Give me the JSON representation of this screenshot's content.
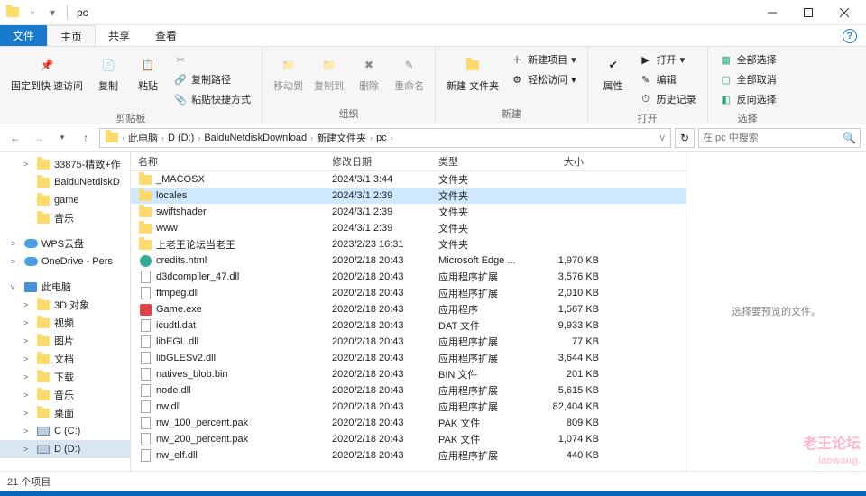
{
  "window": {
    "title": "pc"
  },
  "tabs": {
    "file": "文件",
    "home": "主页",
    "share": "共享",
    "view": "查看"
  },
  "ribbon": {
    "clipboard": {
      "label": "剪贴板",
      "pin": "固定到快\n速访问",
      "copy": "复制",
      "paste": "粘贴",
      "copy_path": "复制路径",
      "paste_shortcut": "粘贴快捷方式"
    },
    "organize": {
      "label": "组织",
      "move_to": "移动到",
      "copy_to": "复制到",
      "delete": "删除",
      "rename": "重命名"
    },
    "new": {
      "label": "新建",
      "new_folder": "新建\n文件夹",
      "new_item": "新建项目",
      "easy_access": "轻松访问"
    },
    "open": {
      "label": "打开",
      "properties": "属性",
      "open": "打开",
      "edit": "编辑",
      "history": "历史记录"
    },
    "select": {
      "label": "选择",
      "select_all": "全部选择",
      "select_none": "全部取消",
      "invert": "反向选择"
    }
  },
  "breadcrumb": [
    "此电脑",
    "D (D:)",
    "BaiduNetdiskDownload",
    "新建文件夹",
    "pc"
  ],
  "addr": {
    "dropdown": "v",
    "refresh": "↻"
  },
  "search": {
    "placeholder": "在 pc 中搜索"
  },
  "columns": {
    "name": "名称",
    "date": "修改日期",
    "type": "类型",
    "size": "大小"
  },
  "tree": {
    "items": [
      {
        "label": "33875-精致+作",
        "icon": "folder",
        "indent": 1,
        "exp": ">"
      },
      {
        "label": "BaiduNetdiskD",
        "icon": "folder",
        "indent": 1
      },
      {
        "label": "game",
        "icon": "folder",
        "indent": 1
      },
      {
        "label": "音乐",
        "icon": "folder",
        "indent": 1
      },
      {
        "sep": true
      },
      {
        "label": "WPS云盘",
        "icon": "cloud",
        "indent": 0,
        "exp": ">"
      },
      {
        "label": "OneDrive - Pers",
        "icon": "cloud",
        "indent": 0,
        "exp": ">"
      },
      {
        "sep": true
      },
      {
        "label": "此电脑",
        "icon": "pc",
        "indent": 0,
        "exp": "v"
      },
      {
        "label": "3D 对象",
        "icon": "folder",
        "indent": 1,
        "exp": ">"
      },
      {
        "label": "视频",
        "icon": "folder",
        "indent": 1,
        "exp": ">"
      },
      {
        "label": "图片",
        "icon": "folder",
        "indent": 1,
        "exp": ">"
      },
      {
        "label": "文档",
        "icon": "folder",
        "indent": 1,
        "exp": ">"
      },
      {
        "label": "下载",
        "icon": "folder",
        "indent": 1,
        "exp": ">"
      },
      {
        "label": "音乐",
        "icon": "folder",
        "indent": 1,
        "exp": ">"
      },
      {
        "label": "桌面",
        "icon": "folder",
        "indent": 1,
        "exp": ">"
      },
      {
        "label": "C (C:)",
        "icon": "drive",
        "indent": 1,
        "exp": ">"
      },
      {
        "label": "D (D:)",
        "icon": "drive",
        "indent": 1,
        "exp": ">",
        "sel": true
      }
    ]
  },
  "files": [
    {
      "name": "_MACOSX",
      "date": "2024/3/1 3:44",
      "type": "文件夹",
      "size": "",
      "icon": "folder"
    },
    {
      "name": "locales",
      "date": "2024/3/1 2:39",
      "type": "文件夹",
      "size": "",
      "icon": "folder",
      "sel": true
    },
    {
      "name": "swiftshader",
      "date": "2024/3/1 2:39",
      "type": "文件夹",
      "size": "",
      "icon": "folder"
    },
    {
      "name": "www",
      "date": "2024/3/1 2:39",
      "type": "文件夹",
      "size": "",
      "icon": "folder"
    },
    {
      "name": "上老王论坛当老王",
      "date": "2023/2/23 16:31",
      "type": "文件夹",
      "size": "",
      "icon": "folder"
    },
    {
      "name": "credits.html",
      "date": "2020/2/18 20:43",
      "type": "Microsoft Edge ...",
      "size": "1,970 KB",
      "icon": "html"
    },
    {
      "name": "d3dcompiler_47.dll",
      "date": "2020/2/18 20:43",
      "type": "应用程序扩展",
      "size": "3,576 KB",
      "icon": "file"
    },
    {
      "name": "ffmpeg.dll",
      "date": "2020/2/18 20:43",
      "type": "应用程序扩展",
      "size": "2,010 KB",
      "icon": "file"
    },
    {
      "name": "Game.exe",
      "date": "2020/2/18 20:43",
      "type": "应用程序",
      "size": "1,567 KB",
      "icon": "exe"
    },
    {
      "name": "icudtl.dat",
      "date": "2020/2/18 20:43",
      "type": "DAT 文件",
      "size": "9,933 KB",
      "icon": "file"
    },
    {
      "name": "libEGL.dll",
      "date": "2020/2/18 20:43",
      "type": "应用程序扩展",
      "size": "77 KB",
      "icon": "file"
    },
    {
      "name": "libGLESv2.dll",
      "date": "2020/2/18 20:43",
      "type": "应用程序扩展",
      "size": "3,644 KB",
      "icon": "file"
    },
    {
      "name": "natives_blob.bin",
      "date": "2020/2/18 20:43",
      "type": "BIN 文件",
      "size": "201 KB",
      "icon": "file"
    },
    {
      "name": "node.dll",
      "date": "2020/2/18 20:43",
      "type": "应用程序扩展",
      "size": "5,615 KB",
      "icon": "file"
    },
    {
      "name": "nw.dll",
      "date": "2020/2/18 20:43",
      "type": "应用程序扩展",
      "size": "82,404 KB",
      "icon": "file"
    },
    {
      "name": "nw_100_percent.pak",
      "date": "2020/2/18 20:43",
      "type": "PAK 文件",
      "size": "809 KB",
      "icon": "file"
    },
    {
      "name": "nw_200_percent.pak",
      "date": "2020/2/18 20:43",
      "type": "PAK 文件",
      "size": "1,074 KB",
      "icon": "file"
    },
    {
      "name": "nw_elf.dll",
      "date": "2020/2/18 20:43",
      "type": "应用程序扩展",
      "size": "440 KB",
      "icon": "file"
    }
  ],
  "preview": {
    "text": "选择要预览的文件。"
  },
  "status": {
    "count": "21 个项目"
  },
  "watermark": {
    "line1": "老王论坛",
    "line2": "laowang."
  }
}
